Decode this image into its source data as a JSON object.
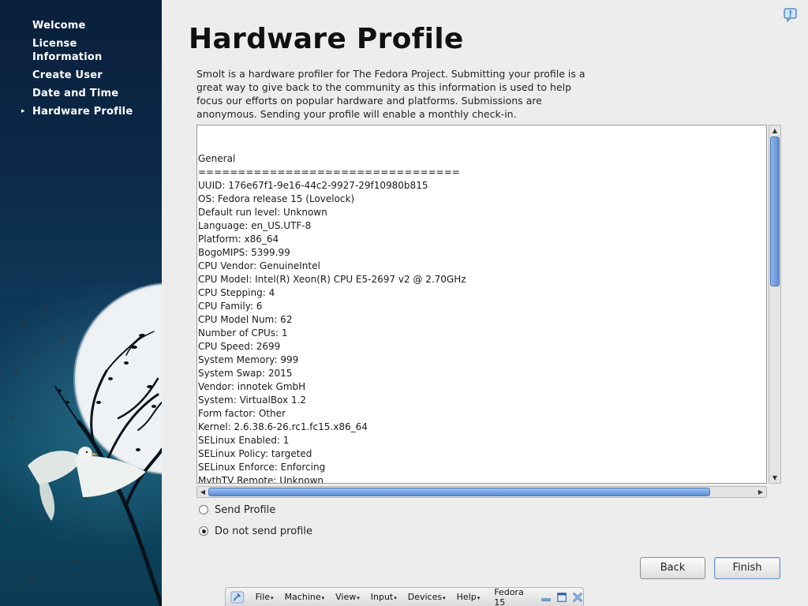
{
  "sidebar": {
    "items": [
      {
        "label": "Welcome"
      },
      {
        "label": "License Information"
      },
      {
        "label": "Create User"
      },
      {
        "label": "Date and Time"
      },
      {
        "label": "Hardware Profile",
        "active": true
      }
    ],
    "active_marker": "▸"
  },
  "page": {
    "title": "Hardware Profile",
    "intro": "Smolt is a hardware profiler for The Fedora Project.  Submitting your profile is a great way to give back to the community as this information is used to help focus our efforts on popular hardware and platforms.  Submissions are anonymous.  Sending your profile will enable a monthly check-in."
  },
  "profile": {
    "lines": [
      "General",
      "=================================",
      "UUID: 176e67f1-9e16-44c2-9927-29f10980b815",
      "OS: Fedora release 15 (Lovelock)",
      "Default run level: Unknown",
      "Language: en_US.UTF-8",
      "Platform: x86_64",
      "BogoMIPS: 5399.99",
      "CPU Vendor: GenuineIntel",
      "CPU Model: Intel(R) Xeon(R) CPU E5-2697 v2 @ 2.70GHz",
      "CPU Stepping: 4",
      "CPU Family: 6",
      "CPU Model Num: 62",
      "Number of CPUs: 1",
      "CPU Speed: 2699",
      "System Memory: 999",
      "System Swap: 2015",
      "Vendor: innotek GmbH",
      "System: VirtualBox 1.2",
      "Form factor: Other",
      "Kernel: 2.6.38.6-26.rc1.fc15.x86_64",
      "SELinux Enabled: 1",
      "SELinux Policy: targeted",
      "SELinux Enforce: Enforcing",
      "MythTV Remote: Unknown"
    ]
  },
  "options": {
    "send_label": "Send Profile",
    "no_send_label": "Do not send profile",
    "selected": "no_send"
  },
  "buttons": {
    "back": "Back",
    "finish": "Finish"
  },
  "vbox": {
    "menus": [
      "File",
      "Machine",
      "View",
      "Input",
      "Devices",
      "Help"
    ],
    "vm_name": "Fedora 15"
  },
  "colors": {
    "accent": "#5d8fd4",
    "sidebar_bg": "#0c2a4a"
  }
}
